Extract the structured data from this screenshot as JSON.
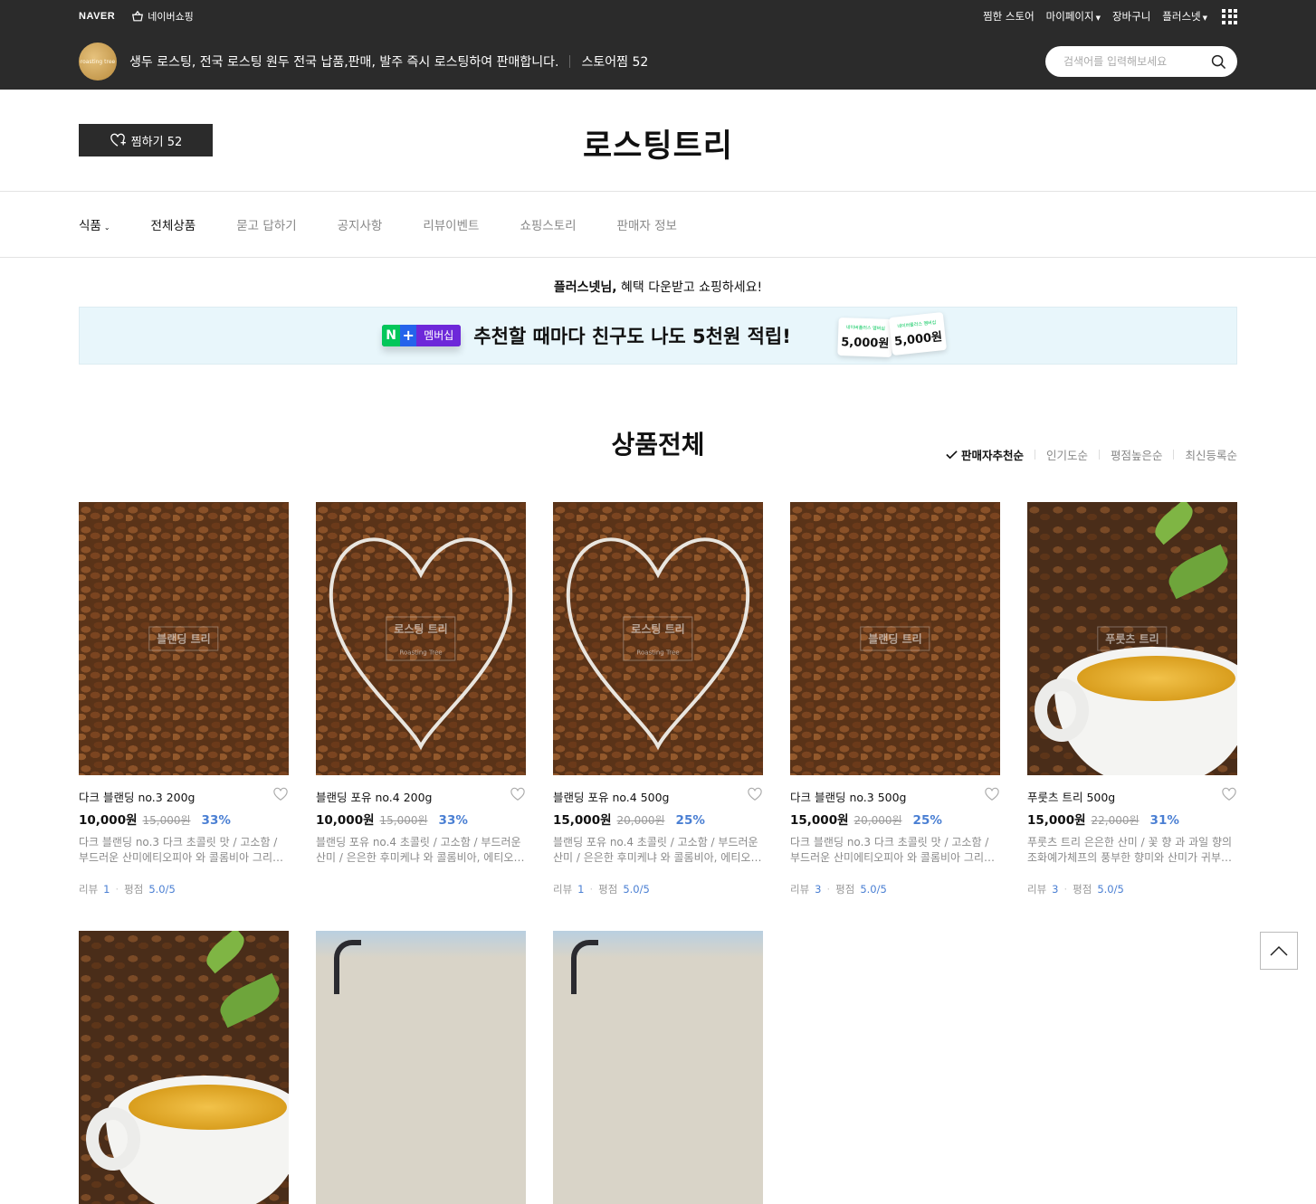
{
  "gnb": {
    "naver_logo": "NAVER",
    "naver_shopping": "네이버쇼핑",
    "right_items": [
      {
        "label": "찜한 스토어",
        "caret": false
      },
      {
        "label": "마이페이지",
        "caret": true
      },
      {
        "label": "장바구니",
        "caret": false
      },
      {
        "label": "플러스넷",
        "caret": true
      }
    ]
  },
  "store_header": {
    "logo_text": "roasting tree",
    "description": "생두 로스팅, 전국 로스팅 원두 전국 납품,판매, 발주 즉시 로스팅하여 판매합니다.",
    "favorites": "스토어찜 52",
    "search_placeholder": "검색어를 입력해보세요"
  },
  "title_area": {
    "fav_button": "찜하기 52",
    "store_name": "로스팅트리"
  },
  "category_nav": [
    {
      "label": "식품",
      "caret": true,
      "dark": true
    },
    {
      "label": "전체상품",
      "caret": false,
      "dark": true
    },
    {
      "label": "묻고 답하기",
      "caret": false,
      "dark": false
    },
    {
      "label": "공지사항",
      "caret": false,
      "dark": false
    },
    {
      "label": "리뷰이벤트",
      "caret": false,
      "dark": false
    },
    {
      "label": "쇼핑스토리",
      "caret": false,
      "dark": false
    },
    {
      "label": "판매자 정보",
      "caret": false,
      "dark": false
    }
  ],
  "benefit": {
    "user": "플러스넷님,",
    "message": " 혜택 다운받고 쇼핑하세요!",
    "banner_badge_n": "N",
    "banner_badge_plus": "+",
    "banner_badge_member": "멤버십",
    "banner_message": "추천할 때마다 친구도 나도 5천원 적립!",
    "coupon_caption": "네이버플러스 멤버십",
    "coupon_1": "5,000원",
    "coupon_2": "5,000원"
  },
  "products_section": {
    "title": "상품전체",
    "sort_options": [
      {
        "label": "판매자추천순",
        "active": true
      },
      {
        "label": "인기도순",
        "active": false
      },
      {
        "label": "평점높은순",
        "active": false
      },
      {
        "label": "최신등록순",
        "active": false
      }
    ]
  },
  "products": [
    {
      "name": "다크 블랜딩 no.3 200g",
      "price": "10,000원",
      "original": "15,000원",
      "discount": "33%",
      "desc": "다크 블랜딩 no.3 다크 초콜릿 맛 / 고소함 / 부드러운 산미에티오피아 와 콜롬비아 그리고 브라질",
      "review_label": "리뷰",
      "review_count": "1",
      "rating_label": "평점",
      "rating": "5.0",
      "rating_max": "/5",
      "image": "beans",
      "watermark": "블랜딩 트리",
      "watermark_sub": ""
    },
    {
      "name": "블랜딩 포유 no.4 200g",
      "price": "10,000원",
      "original": "15,000원",
      "discount": "33%",
      "desc": "블랜딩 포유 no.4 초콜릿 / 고소함 / 부드러운 산미 / 은은한 후미케냐 와 콜롬비아, 에티오피아",
      "review_label": "",
      "review_count": "",
      "rating_label": "",
      "rating": "",
      "rating_max": "",
      "image": "heart",
      "watermark": "로스팅 트리",
      "watermark_sub": "Roasting Tree"
    },
    {
      "name": "블랜딩 포유 no.4 500g",
      "price": "15,000원",
      "original": "20,000원",
      "discount": "25%",
      "desc": "블랜딩 포유 no.4 초콜릿 / 고소함 / 부드러운 산미 / 은은한 후미케냐 와 콜롬비아, 에티오피아",
      "review_label": "리뷰",
      "review_count": "1",
      "rating_label": "평점",
      "rating": "5.0",
      "rating_max": "/5",
      "image": "heart",
      "watermark": "로스팅 트리",
      "watermark_sub": "Roasting Tree"
    },
    {
      "name": "다크 블랜딩 no.3 500g",
      "price": "15,000원",
      "original": "20,000원",
      "discount": "25%",
      "desc": "다크 블랜딩 no.3 다크 초콜릿 맛 / 고소함 / 부드러운 산미에티오피아 와 콜롬비아 그리고 브라질",
      "review_label": "리뷰",
      "review_count": "3",
      "rating_label": "평점",
      "rating": "5.0",
      "rating_max": "/5",
      "image": "beans",
      "watermark": "블랜딩 트리",
      "watermark_sub": ""
    },
    {
      "name": "푸룻츠 트리 500g",
      "price": "15,000원",
      "original": "22,000원",
      "discount": "31%",
      "desc": "푸룻츠 트리 은은한 산미 / 꽃 향 과 과일 향의 조화예가체프의 풍부한 향미와 산미가 귀부와인",
      "review_label": "리뷰",
      "review_count": "3",
      "rating_label": "평점",
      "rating": "5.0",
      "rating_max": "/5",
      "image": "cup",
      "watermark": "푸룻츠 트리",
      "watermark_sub": ""
    },
    {
      "name": "",
      "price": "",
      "original": "",
      "discount": "",
      "desc": "",
      "review_label": "",
      "review_count": "",
      "rating_label": "",
      "rating": "",
      "rating_max": "",
      "image": "cup",
      "watermark": "",
      "watermark_sub": ""
    },
    {
      "name": "",
      "price": "",
      "original": "",
      "discount": "",
      "desc": "",
      "review_label": "",
      "review_count": "",
      "rating_label": "",
      "rating": "",
      "rating_max": "",
      "image": "bag",
      "watermark": "",
      "watermark_sub": ""
    },
    {
      "name": "",
      "price": "",
      "original": "",
      "discount": "",
      "desc": "",
      "review_label": "",
      "review_count": "",
      "rating_label": "",
      "rating": "",
      "rating_max": "",
      "image": "bag",
      "watermark": "",
      "watermark_sub": ""
    }
  ],
  "colors": {
    "header_bg": "#2b2b2b",
    "accent_blue": "#4a7fd3",
    "banner_bg": "#e8f6fb",
    "naver_green": "#03c75a"
  }
}
